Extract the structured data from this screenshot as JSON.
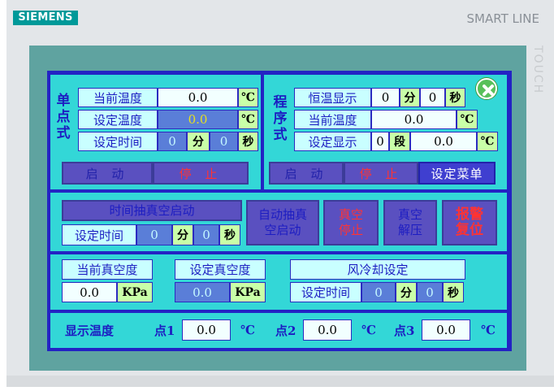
{
  "brand": {
    "left": "SIEMENS",
    "right": "SMART LINE",
    "side": "TOUCH"
  },
  "single": {
    "title_chars": [
      "单",
      "点",
      "式"
    ],
    "current_temp_label": "当前温度",
    "current_temp_value": "0.0",
    "current_temp_unit": "℃",
    "set_temp_label": "设定温度",
    "set_temp_value": "0.0",
    "set_temp_unit": "℃",
    "set_time_label": "设定时间",
    "set_time_min": "0",
    "min_unit": "分",
    "set_time_sec": "0",
    "sec_unit": "秒",
    "start": "启 动",
    "stop": "停 止"
  },
  "program": {
    "title_chars": [
      "程",
      "序",
      "式"
    ],
    "hold_label": "恒温显示",
    "hold_min": "0",
    "min_unit": "分",
    "hold_sec": "0",
    "sec_unit": "秒",
    "current_temp_label": "当前温度",
    "current_temp_value": "0.0",
    "current_temp_unit": "℃",
    "set_disp_label": "设定显示",
    "segment_value": "0",
    "segment_unit": "段",
    "set_temp_value": "0.0",
    "set_temp_unit": "℃",
    "start": "启 动",
    "stop": "停 止",
    "menu": "设定菜单"
  },
  "vacuum": {
    "timed_start": "时间抽真空启动",
    "set_time_label": "设定时间",
    "set_time_min": "0",
    "min_unit": "分",
    "set_time_sec": "0",
    "sec_unit": "秒",
    "auto_start_1": "自动抽真",
    "auto_start_2": "空启动",
    "stop_1": "真空",
    "stop_2": "停止",
    "release_1": "真空",
    "release_2": "解压",
    "alarm_1": "报警",
    "alarm_2": "复位"
  },
  "status": {
    "current_vac_label": "当前真空度",
    "current_vac_value": "0.0",
    "current_vac_unit": "KPa",
    "set_vac_label": "设定真空度",
    "set_vac_value": "0.0",
    "set_vac_unit": "KPa",
    "cooling_label": "风冷却设定",
    "cooling_time_label": "设定时间",
    "cooling_min": "0",
    "min_unit": "分",
    "cooling_sec": "0",
    "sec_unit": "秒"
  },
  "display": {
    "label": "显示温度",
    "p1_label": "点1",
    "p1_value": "0.0",
    "p1_unit": "℃",
    "p2_label": "点2",
    "p2_value": "0.0",
    "p2_unit": "℃",
    "p3_label": "点3",
    "p3_value": "0.0",
    "p3_unit": "℃"
  },
  "colors": {
    "panel": "#33d7d7",
    "screen_bg": "#2323c4",
    "brand": "#009999",
    "stop_text": "#ff3333",
    "close": "#58c05a"
  },
  "icons": {
    "close": "close-icon"
  }
}
